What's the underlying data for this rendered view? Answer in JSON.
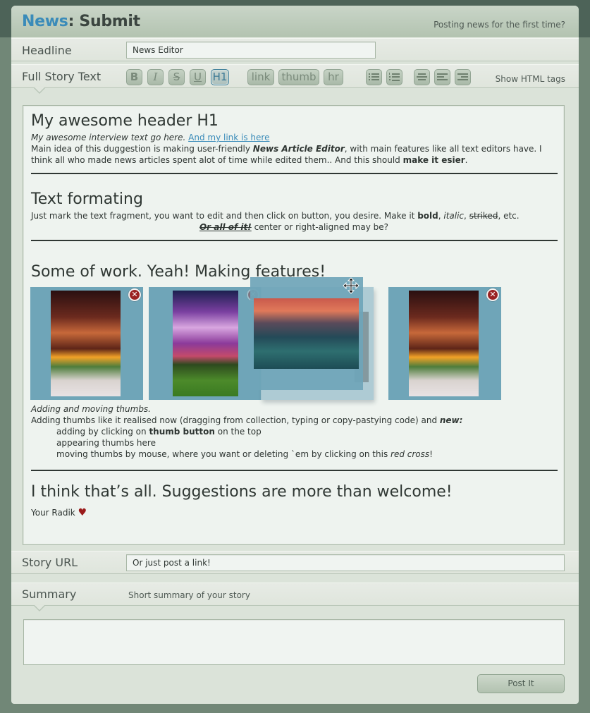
{
  "header": {
    "title_accent": "News",
    "title_rest": ": Submit",
    "help_link": "Posting news for the first time?"
  },
  "headline": {
    "label": "Headline",
    "value": "News Editor"
  },
  "story_text": {
    "label": "Full Story Text",
    "toolbar": {
      "bold": "B",
      "italic": "I",
      "strike": "S",
      "underline": "U",
      "h1": "H1",
      "link": "link",
      "thumb": "thumb",
      "hr": "hr",
      "unordered_list_icon": "bulleted-list-icon",
      "ordered_list_icon": "numbered-list-icon",
      "align_center_icon": "align-center-icon",
      "align_left_icon": "align-left-icon",
      "align_right_icon": "align-right-icon",
      "show_html": "Show HTML tags"
    },
    "content": {
      "h1_1": "My awesome header H1",
      "p1_italic": "My awesome interview text go here.",
      "p1_link": "And my link is here",
      "p2_a": "Main idea of this duggestion is making user-friendly ",
      "p2_bi": "News Article Editor",
      "p2_b": ", with main features like all text editors have. I think all who made news articles spent alot of time while edited them.. And this should ",
      "p2_bold": "make it esier",
      "p2_end": ".",
      "h1_2": "Text formating",
      "p3_a": "Just mark the text fragment, you want to edit and then click on button, you desire. Make it ",
      "p3_bold": "bold",
      "p3_c1": ", ",
      "p3_italic": "italic",
      "p3_c2": ", ",
      "p3_strike": "striked",
      "p3_end": ", etc.",
      "p4_all": "Or all of it!",
      "p4_rest": " center or right-aligned may be?",
      "h1_3": "Some of work. Yeah! Making features!",
      "thumbs": [
        {
          "name": "cannon-sunset",
          "delete_icon": "red-cross-icon"
        },
        {
          "name": "purple-clouds-field",
          "delete_icon": "red-cross-icon"
        },
        {
          "name": "sunset-beach",
          "state": "dragging"
        },
        {
          "name": "cannon-sunset",
          "delete_icon": "red-cross-icon"
        }
      ],
      "caption": "Adding and moving thumbs.",
      "p5_a": "Adding thumbs like it realised now (dragging from collection, typing or copy-pastying code) and ",
      "p5_new": "new:",
      "li1_a": "adding by clicking on ",
      "li1_bold": "thumb button",
      "li1_b": " on the top",
      "li2": "appearing thumbs here",
      "li3_a": "moving thumbs by mouse, where you want or deleting `em by clicking on this ",
      "li3_italic": "red cross",
      "li3_end": "!",
      "h1_4": "I think that’s all. Suggestions are more than welcome!",
      "signature": "Your Radik"
    }
  },
  "story_url": {
    "label": "Story URL",
    "value": "Or just post a link!"
  },
  "summary": {
    "label": "Summary",
    "hint": "Short summary of your story",
    "value": ""
  },
  "submit": {
    "label": "Post It"
  }
}
